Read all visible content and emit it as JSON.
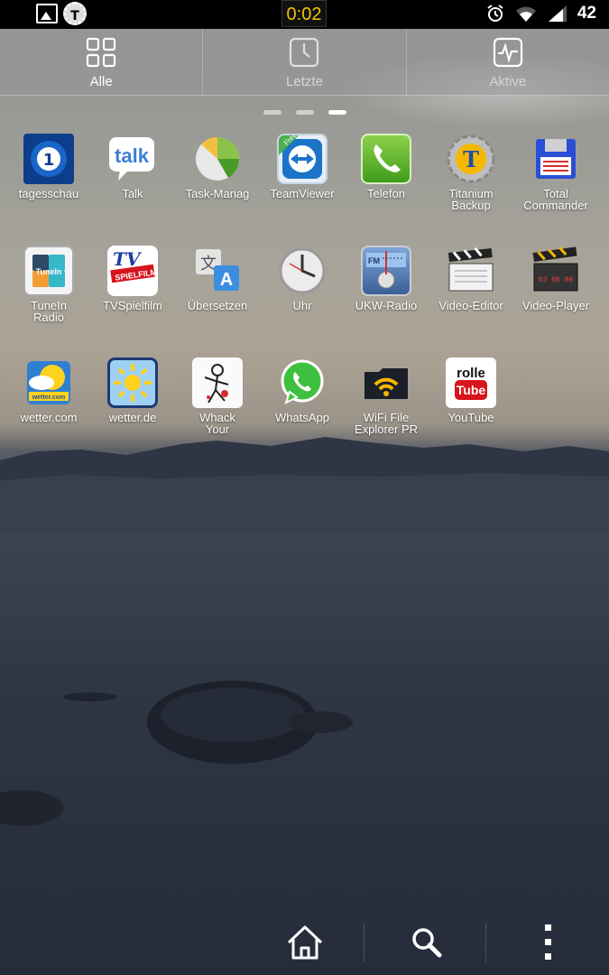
{
  "status_bar": {
    "time": "0:02",
    "battery": "42",
    "icons": [
      "gallery-notification-icon",
      "titanium-backup-notification-icon",
      "alarm-icon",
      "wifi-icon",
      "signal-icon"
    ]
  },
  "tabs": [
    {
      "label": "Alle",
      "icon": "grid-icon",
      "active": true
    },
    {
      "label": "Letzte",
      "icon": "clock-icon",
      "active": false
    },
    {
      "label": "Aktive",
      "icon": "activity-icon",
      "active": false
    }
  ],
  "pager": {
    "pages": 3,
    "current": 3
  },
  "apps": [
    {
      "label": "tagesschau",
      "icon": "tagesschau-icon"
    },
    {
      "label": "Talk",
      "icon": "talk-icon"
    },
    {
      "label": "Task-Manag",
      "icon": "task-manager-icon"
    },
    {
      "label": "TeamViewer",
      "icon": "teamviewer-icon"
    },
    {
      "label": "Telefon",
      "icon": "phone-icon"
    },
    {
      "label": "Titanium\nBackup",
      "icon": "titanium-backup-icon"
    },
    {
      "label": "Total\nCommander",
      "icon": "total-commander-icon"
    },
    {
      "label": "TuneIn\nRadio",
      "icon": "tunein-radio-icon"
    },
    {
      "label": "TVSpielfilm",
      "icon": "tvspielfilm-icon"
    },
    {
      "label": "Übersetzen",
      "icon": "translate-icon"
    },
    {
      "label": "Uhr",
      "icon": "clock-app-icon"
    },
    {
      "label": "UKW-Radio",
      "icon": "fm-radio-icon"
    },
    {
      "label": "Video-Editor",
      "icon": "video-editor-icon"
    },
    {
      "label": "Video-Player",
      "icon": "video-player-icon"
    },
    {
      "label": "wetter.com",
      "icon": "wetter-com-icon"
    },
    {
      "label": "wetter.de",
      "icon": "wetter-de-icon"
    },
    {
      "label": "Whack\nYour",
      "icon": "whack-your-icon"
    },
    {
      "label": "WhatsApp",
      "icon": "whatsapp-icon"
    },
    {
      "label": "WiFi File\nExplorer PR",
      "icon": "wifi-file-explorer-icon"
    },
    {
      "label": "YouTube",
      "icon": "youtube-icon"
    }
  ],
  "icon_texts": {
    "talk": "talk",
    "tunein": "TuneIn",
    "tv": "TV",
    "spielfilm": "SPIELFILM",
    "wetter": "wetter.com",
    "rolle": "rolle",
    "tube": "Tube",
    "free": "Free",
    "fm": "FM",
    "clapper_code": "03 06 89"
  },
  "nav": [
    "home-icon",
    "search-icon",
    "menu-icon"
  ],
  "colors": {
    "status_time": "#f4c400",
    "tab_active_text": "#ffffff"
  }
}
